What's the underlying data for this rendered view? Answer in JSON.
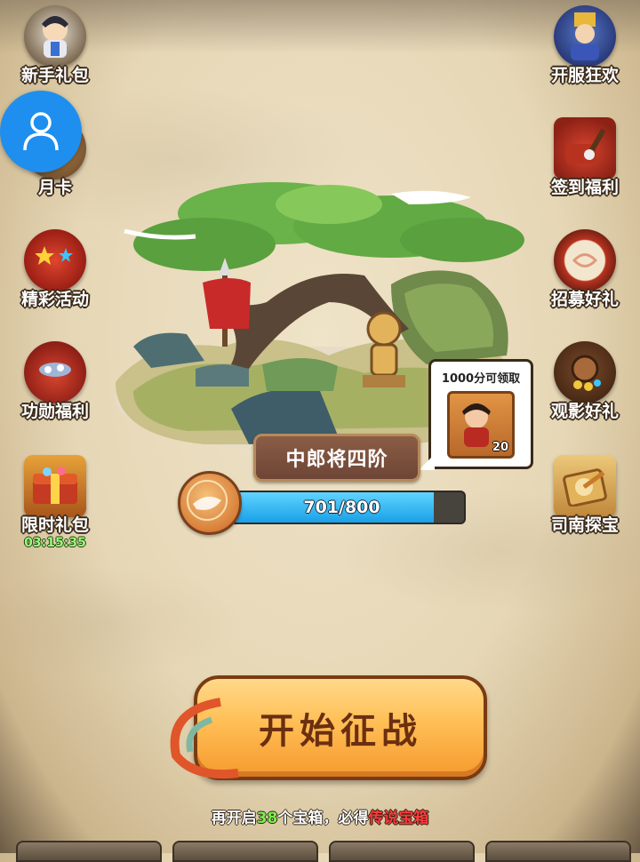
{
  "left_menu": [
    {
      "label": "新手礼包",
      "icon": "hero-gift-icon"
    },
    {
      "label": "月卡",
      "icon": "monthly-card-icon"
    },
    {
      "label": "精彩活动",
      "icon": "event-bag-icon"
    },
    {
      "label": "功勋福利",
      "icon": "merit-bag-icon"
    },
    {
      "label": "限时礼包",
      "icon": "treasure-chest-icon",
      "timer": "03:15:35"
    }
  ],
  "right_menu": [
    {
      "label": "开服狂欢",
      "icon": "general-celebration-icon"
    },
    {
      "label": "签到福利",
      "icon": "signin-brush-icon"
    },
    {
      "label": "招募好礼",
      "icon": "drum-icon"
    },
    {
      "label": "观影好礼",
      "icon": "video-drum-icon"
    },
    {
      "label": "司南探宝",
      "icon": "compass-icon"
    }
  ],
  "rank": {
    "title": "中郎将四阶"
  },
  "progress": {
    "text": "701/800",
    "current": 701,
    "max": 800
  },
  "reward": {
    "caption": "1000分可领取",
    "count": "20"
  },
  "start_button": {
    "label": "开始征战"
  },
  "hint": {
    "prefix": "再开启",
    "number": "38",
    "middle": "个宝箱，必得",
    "highlight": "传说宝箱"
  }
}
